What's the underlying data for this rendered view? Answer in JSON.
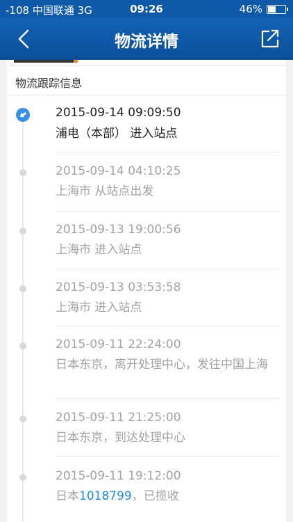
{
  "status_bar": {
    "signal": "-108",
    "carrier": "中国联通",
    "network": "3G",
    "time": "09:26",
    "battery_percent_text": "46%",
    "battery_level": 0.46
  },
  "nav": {
    "title": "物流详情",
    "back_icon": "chevron-left-icon",
    "share_icon": "share-external-icon"
  },
  "section": {
    "title": "物流跟踪信息"
  },
  "entries": [
    {
      "time": "2015-09-14 09:09:50",
      "desc": "浦电（本部） 进入站点",
      "current": true
    },
    {
      "time": "2015-09-14 04:10:25",
      "desc": "上海市 从站点出发"
    },
    {
      "time": "2015-09-13 19:00:56",
      "desc": "上海市 进入站点"
    },
    {
      "time": "2015-09-13 03:53:58",
      "desc": "上海市 进入站点"
    },
    {
      "time": "2015-09-11 22:24:00",
      "desc": "日本东京，离开处理中心，发往中国上海"
    },
    {
      "time": "2015-09-11 21:25:00",
      "desc": "日本东京，到达处理中心"
    },
    {
      "time": "2015-09-11 19:12:00",
      "desc_prefix": "日本",
      "desc_link": "1018799",
      "desc_suffix": "，已揽收"
    }
  ],
  "colors": {
    "nav_blue": "#0f5aa8",
    "link_blue": "#1f8ae0",
    "current_dot": "#3a8fe0"
  }
}
